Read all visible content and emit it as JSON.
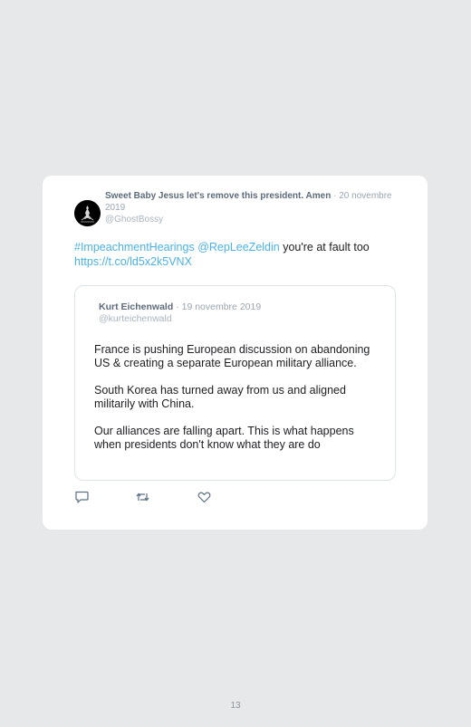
{
  "tweet": {
    "author_name": "Sweet Baby Jesus let's remove this president. Amen",
    "separator": "·",
    "date": "20 novembre 2019",
    "handle": "@GhostBossy",
    "avatar_icon": "dark-figure-avatar",
    "text": {
      "hashtag": "#ImpeachmentHearings",
      "mention": "@RepLeeZeldin",
      "plain": "you're at fault too",
      "link": "https://t.co/ld5x2k5VNX"
    }
  },
  "quoted_tweet": {
    "author_name": "Kurt Eichenwald",
    "separator": "·",
    "date": "19 novembre 2019",
    "handle": "@kurteichenwald",
    "paragraphs": [
      "France is pushing European discussion on abandoning US & creating a separate European military alliance.",
      "South Korea has turned away from us and aligned militarily with China.",
      "Our alliances are falling apart. This is what happens when presidents don't know what they are do"
    ]
  },
  "actions": {
    "reply_icon": "reply-icon",
    "retweet_icon": "retweet-icon",
    "like_icon": "heart-icon"
  },
  "colors": {
    "link": "#4ab2e6",
    "background": "#e6e8ea",
    "card": "#ffffff"
  },
  "page_number": "13"
}
